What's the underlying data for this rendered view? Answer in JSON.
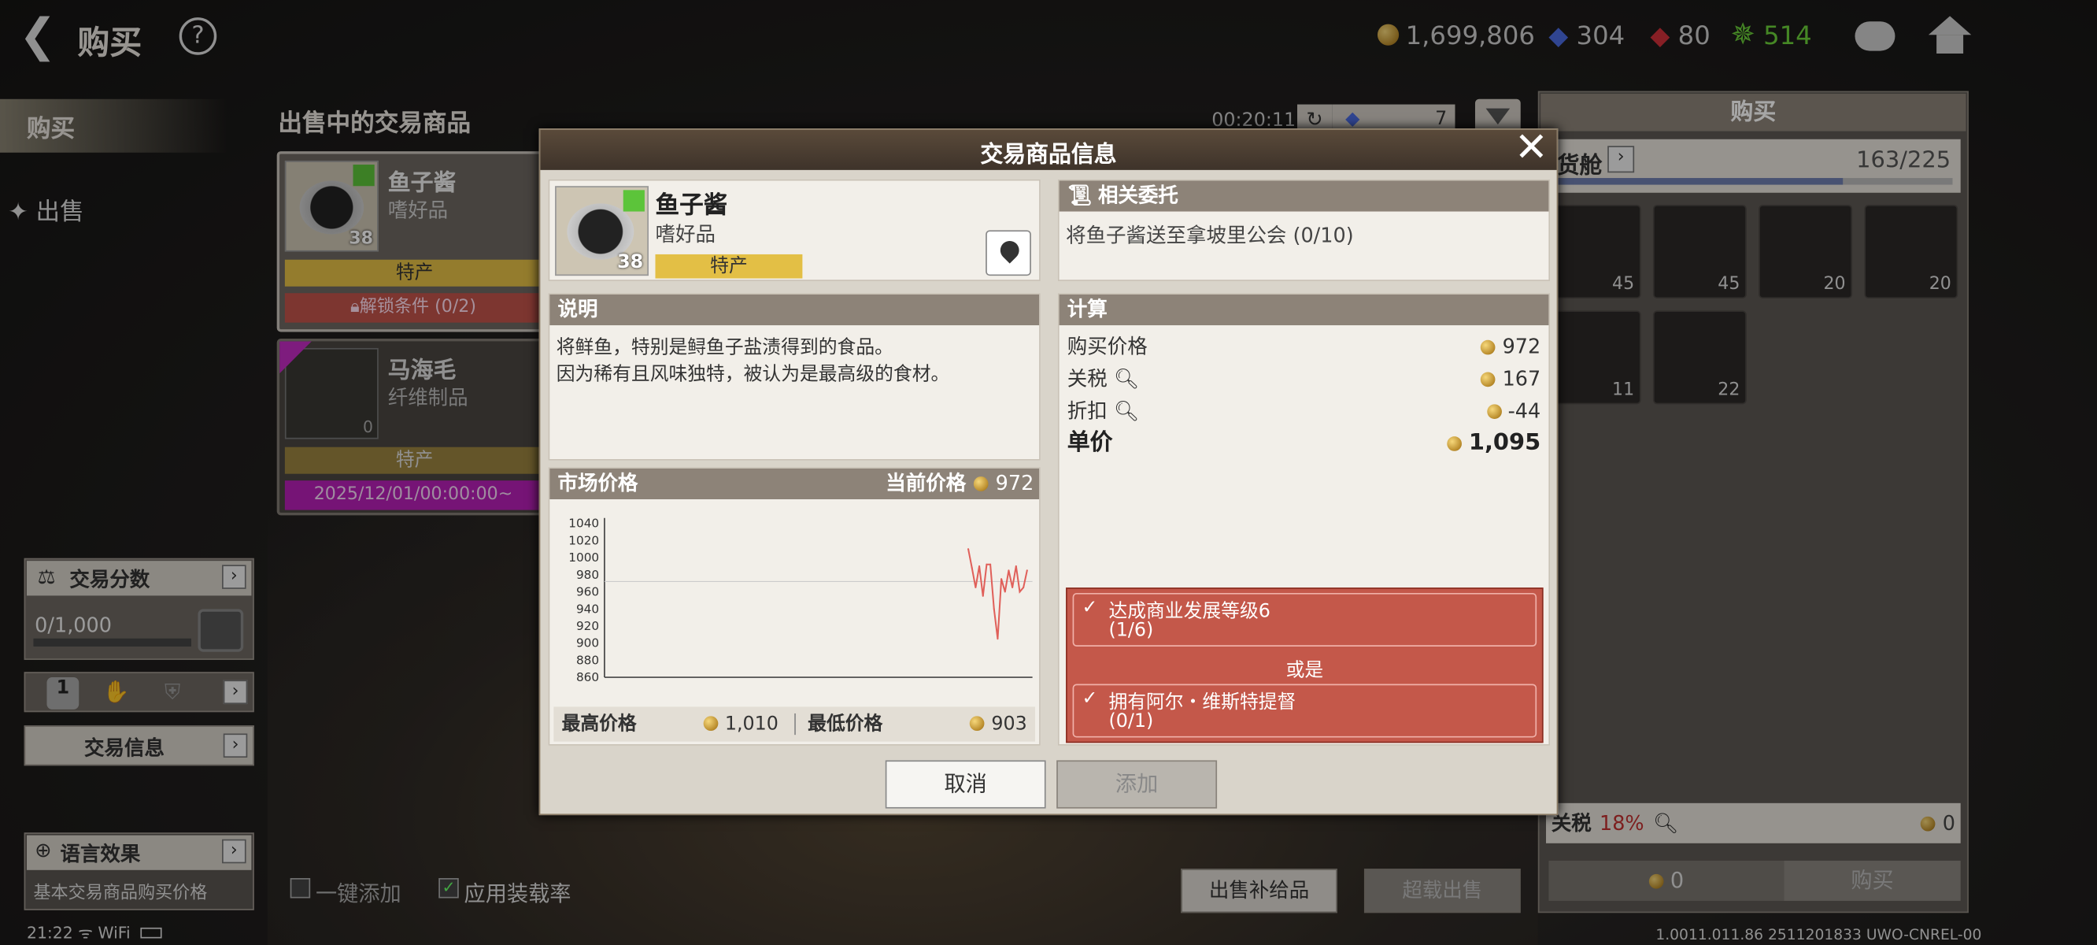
{
  "topbar": {
    "title": "购买",
    "gold": "1,699,806",
    "gems": "304",
    "rubies": "80",
    "wheel": "514"
  },
  "sidebar": {
    "buy": "购买",
    "sell": "出售",
    "score_title": "交易分数",
    "score_value": "0/1,000",
    "rank": "1",
    "trade_info": "交易信息",
    "lang_title": "语言效果",
    "lang_desc": "基本交易商品购买价格"
  },
  "list": {
    "title": "出售中的交易商品",
    "timer": "00:20:11",
    "count": "7",
    "items": [
      {
        "name": "鱼子酱",
        "cat": "嗜好品",
        "qty": "38",
        "tag": "特产",
        "foot": "解锁条件 (0/2)"
      },
      {
        "name": "马海毛",
        "cat": "纤维制品",
        "qty": "0",
        "tag": "特产",
        "foot": "2025/12/01/00:00:00~"
      }
    ]
  },
  "bottom": {
    "one_click": "一键添加",
    "apply_rate": "应用装载率",
    "sell_supplies": "出售补给品",
    "overload_sell": "超载出售"
  },
  "status": {
    "time": "21:22",
    "wifi": "WiFi",
    "version": "1.0011.011.86 2511201833 UWO-CNREL-00"
  },
  "right": {
    "title": "购买",
    "hold": "货舱",
    "capacity": "163/225",
    "capacity_ratio": 0.724,
    "slots": [
      "45",
      "45",
      "20",
      "20",
      "11",
      "22"
    ],
    "tax_label": "关税",
    "tax_pct": "18%",
    "tax_val": "0",
    "total": "0",
    "buy": "购买"
  },
  "modal": {
    "title": "交易商品信息",
    "item": {
      "name": "鱼子酱",
      "cat": "嗜好品",
      "qty": "38",
      "tag": "特产"
    },
    "desc_title": "说明",
    "desc": [
      "将鲜鱼，特别是鲟鱼子盐渍得到的食品。",
      "因为稀有且风味独特，被认为是最高级的食材。"
    ],
    "market_title": "市场价格",
    "current_label": "当前价格",
    "current_price": "972",
    "high_label": "最高价格",
    "high_price": "1,010",
    "low_label": "最低价格",
    "low_price": "903",
    "quest_title": "相关委托",
    "quest": "将鱼子酱送至拿坡里公会 (0/10)",
    "calc_title": "计算",
    "calc": [
      {
        "label": "购买价格",
        "value": "972"
      },
      {
        "label": "关税",
        "value": "167"
      },
      {
        "label": "折扣",
        "value": "-44"
      }
    ],
    "unit_label": "单价",
    "unit_price": "1,095",
    "req": [
      {
        "text": "达成商业发展等级6",
        "progress": "(1/6)"
      },
      {
        "text": "拥有阿尔・维斯特提督",
        "progress": "(0/1)"
      }
    ],
    "or": "或是",
    "cancel": "取消",
    "add": "添加"
  },
  "chart_data": {
    "type": "line",
    "ylim": [
      860,
      1040
    ],
    "yticks": [
      "1040",
      "1020",
      "1000",
      "980",
      "960",
      "940",
      "920",
      "900",
      "880",
      "860"
    ],
    "series": [
      {
        "values": [
          1010,
          988,
          965,
          990,
          955,
          992,
          992,
          940,
          905,
          975,
          960,
          985,
          965,
          990,
          960,
          965,
          985
        ]
      }
    ],
    "color": "#e0605a"
  }
}
